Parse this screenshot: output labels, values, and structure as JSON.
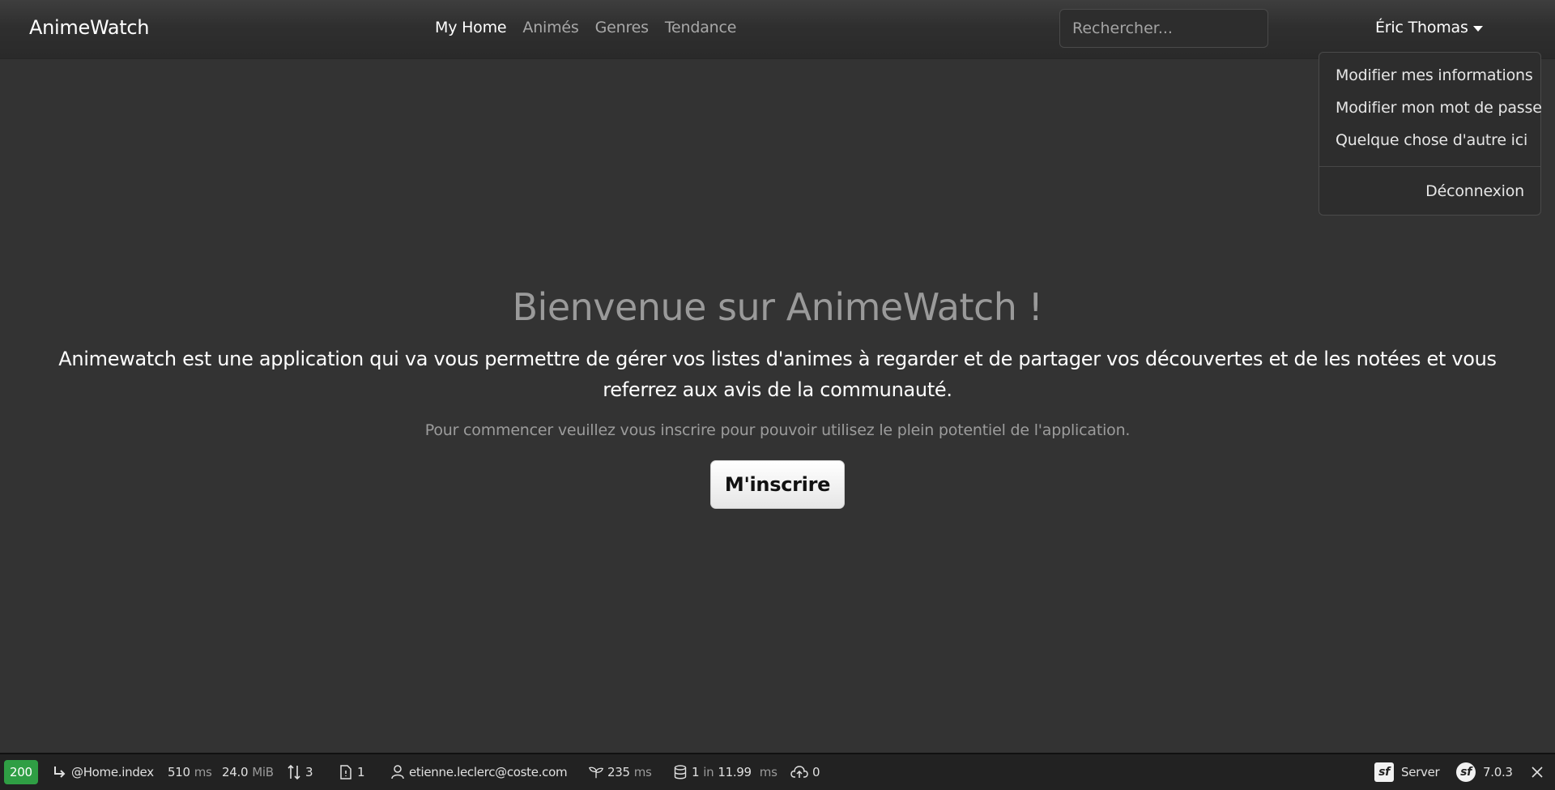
{
  "navbar": {
    "brand": "AnimeWatch",
    "links": [
      {
        "label": "My Home"
      },
      {
        "label": "Animés"
      },
      {
        "label": "Genres"
      },
      {
        "label": "Tendance"
      }
    ],
    "search_placeholder": "Rechercher...",
    "user_name": "Éric Thomas"
  },
  "dropdown": {
    "items": [
      {
        "label": "Modifier mes informations"
      },
      {
        "label": "Modifier mon mot de passe"
      },
      {
        "label": "Quelque chose d'autre ici"
      }
    ],
    "logout": "Déconnexion"
  },
  "hero": {
    "title": "Bienvenue sur AnimeWatch !",
    "lead": "Animewatch est une application qui va vous permettre de gérer vos listes d'animes à regarder et de partager vos découvertes et de les notées et vous referrez aux avis de la communauté.",
    "sub": "Pour commencer veuillez vous inscrire pour pouvoir utilisez le plein potentiel de l'application.",
    "cta": "M'inscrire"
  },
  "debug_toolbar": {
    "status": "200",
    "route": "@Home.index",
    "time_value": "510",
    "time_unit": "ms",
    "memory_value": "24.0",
    "memory_unit": "MiB",
    "requests": "3",
    "forms": "1",
    "user": "etienne.leclerc@coste.com",
    "twig_time": "235",
    "twig_unit": "ms",
    "db_queries": "1",
    "db_in": "in",
    "db_time": "11.99",
    "db_unit": "ms",
    "uploads": "0",
    "server_label": "Server",
    "symfony_version": "7.0.3",
    "colors": {
      "status_ok": "#2f9e44"
    }
  }
}
